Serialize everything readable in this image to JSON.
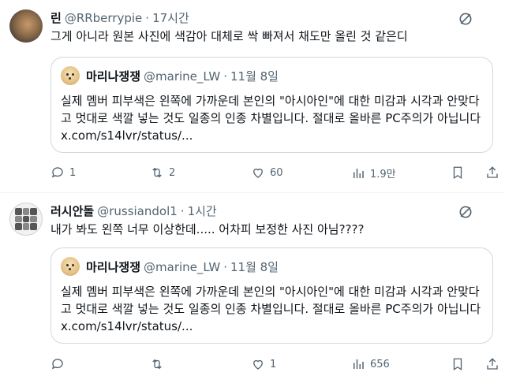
{
  "posts": [
    {
      "author": {
        "name": "린",
        "handle": "@RRberrypie",
        "dot": "·",
        "time": "17시간"
      },
      "text": "그게 아니라 원본 사진에 색감아 대체로 싹 빠져서 채도만 올린 것 같은디",
      "quote": {
        "author": {
          "name": "마리나쟁쟁",
          "handle": "@marine_LW",
          "dot": "·",
          "time": "11월 8일"
        },
        "text": "실제 멤버 피부색은 왼쪽에 가까운데 본인의 \"아시아인\"에 대한 미감과 시각과 안맞다고 멋대로 색깔 넣는 것도 일종의 인종 차별입니다. 절대로 올바른 PC주의가 아닙니다 x.com/s14lvr/status/..."
      },
      "stats": {
        "replies": "1",
        "reposts": "2",
        "likes": "60",
        "views": "1.9만"
      }
    },
    {
      "author": {
        "name": "러시안돌",
        "handle": "@russiandol1",
        "dot": "·",
        "time": "1시간"
      },
      "text": "내가 봐도 왼쪽 너무 이상한데..... 어차피 보정한 사진 아님????",
      "quote": {
        "author": {
          "name": "마리나쟁쟁",
          "handle": "@marine_LW",
          "dot": "·",
          "time": "11월 8일"
        },
        "text": "실제 멤버 피부색은 왼쪽에 가까운데 본인의 \"아시아인\"에 대한 미감과 시각과 안맞다고 멋대로 색깔 넣는 것도 일종의 인종 차별입니다. 절대로 올바른 PC주의가 아닙니다 x.com/s14lvr/status/..."
      },
      "stats": {
        "replies": "",
        "reposts": "",
        "likes": "1",
        "views": "656"
      }
    }
  ],
  "colors": {
    "text": "#0f1419",
    "muted": "#536471",
    "border": "#cfd9de",
    "divider": "#eff3f4"
  },
  "icons": [
    "more-icon",
    "reply-icon",
    "repost-icon",
    "like-icon",
    "views-icon",
    "bookmark-icon",
    "share-icon"
  ]
}
